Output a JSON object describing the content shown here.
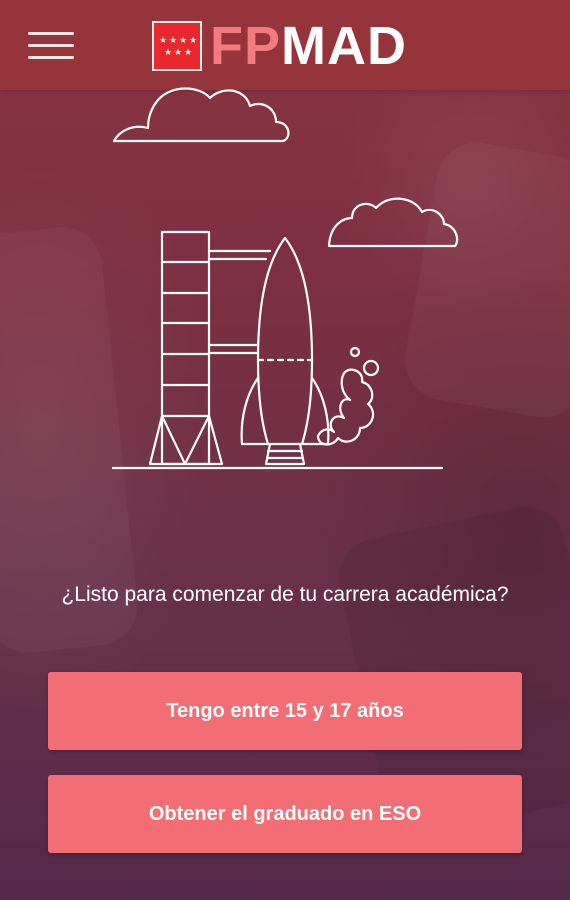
{
  "header": {
    "menu_icon": "hamburger-menu-icon",
    "logo_flag_icon": "madrid-community-flag-icon",
    "logo_fp": "FP",
    "logo_mad": "MAD"
  },
  "illustration": {
    "icons": [
      "cloud-icon",
      "cloud-icon",
      "rocket-icon",
      "launch-tower-icon",
      "smoke-icon"
    ]
  },
  "main": {
    "question": "¿Listo para comenzar de tu carrera académica?",
    "buttons": [
      {
        "label": "Tengo entre 15 y 17 años"
      },
      {
        "label": "Obtener el graduado en ESO"
      }
    ]
  },
  "colors": {
    "accent": "#f26d74",
    "header": "#96343a",
    "logo_fp": "#f37a7f",
    "flag_red": "#e8282e"
  }
}
